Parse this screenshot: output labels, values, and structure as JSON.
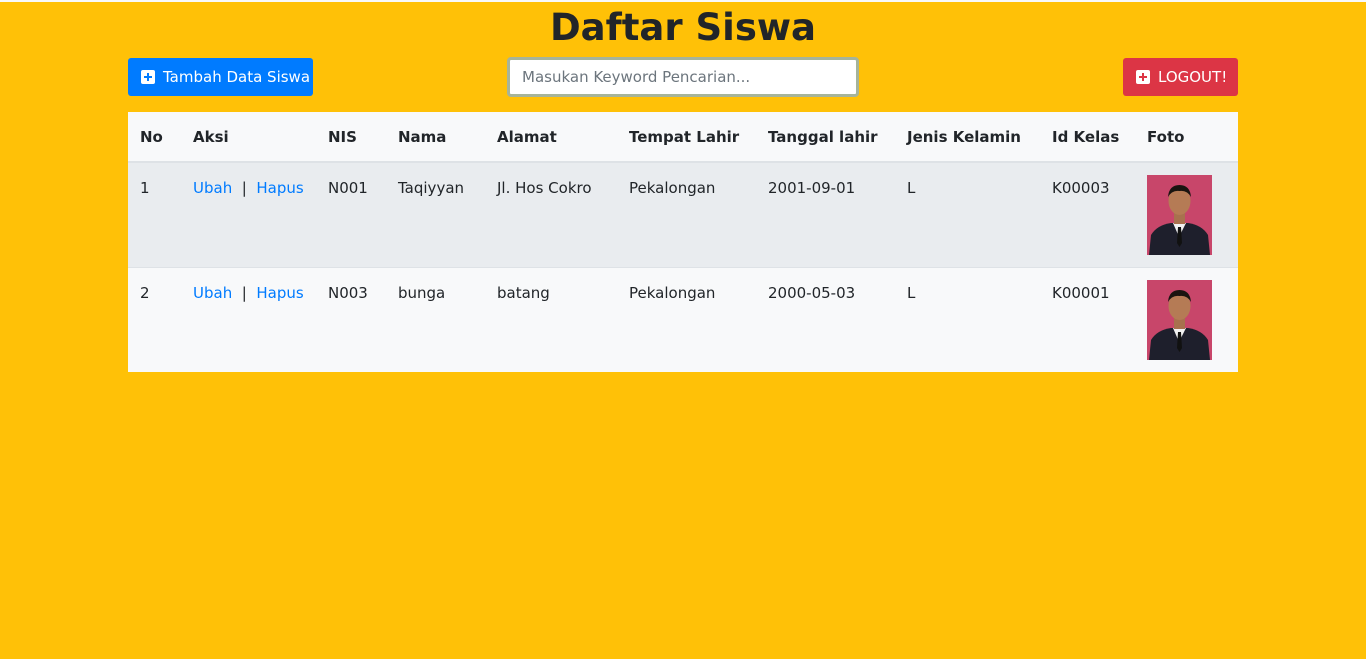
{
  "page": {
    "title": "Daftar Siswa"
  },
  "toolbar": {
    "add_label": "Tambah Data Siswa",
    "logout_label": "LOGOUT!",
    "search_placeholder": "Masukan Keyword Pencarian..."
  },
  "table": {
    "headers": [
      "No",
      "Aksi",
      "NIS",
      "Nama",
      "Alamat",
      "Tempat Lahir",
      "Tanggal lahir",
      "Jenis Kelamin",
      "Id Kelas",
      "Foto"
    ],
    "action_separator": "|",
    "rows": [
      {
        "no": "1",
        "edit": "Ubah",
        "delete": "Hapus",
        "nis": "N001",
        "nama": "Taqiyyan",
        "alamat": "Jl. Hos Cokro",
        "tempat_lahir": "Pekalongan",
        "tanggal_lahir": "2001-09-01",
        "jenis_kelamin": "L",
        "id_kelas": "K00003"
      },
      {
        "no": "2",
        "edit": "Ubah",
        "delete": "Hapus",
        "nis": "N003",
        "nama": "bunga",
        "alamat": "batang",
        "tempat_lahir": "Pekalongan",
        "tanggal_lahir": "2000-05-03",
        "jenis_kelamin": "L",
        "id_kelas": "K00001"
      }
    ]
  },
  "colors": {
    "background": "#ffc107",
    "primary": "#007bff",
    "danger": "#dc3545",
    "photo_background": "#c8466a"
  }
}
